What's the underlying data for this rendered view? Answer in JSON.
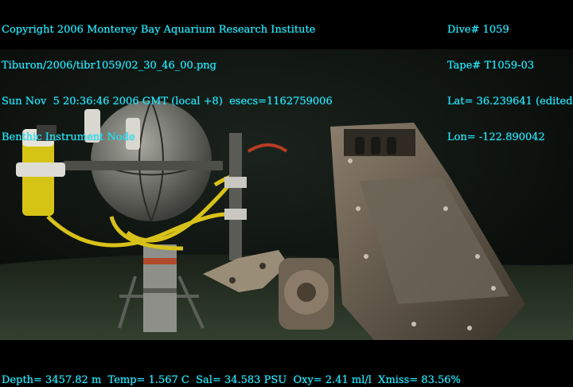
{
  "overlay": {
    "top_left": [
      "Copyright 2006 Monterey Bay Aquarium Research Institute",
      "Tiburon/2006/tibr1059/02_30_46_00.png",
      "Sun Nov  5 20:36:46 2006 GMT (local +8)  esecs=1162759006",
      "Benthic Instrument Node"
    ],
    "top_right": [
      "Dive# 1059",
      "Tape# T1059-03",
      "Lat= 36.239641 (edited)",
      "Lon= -122.890042"
    ],
    "bottom": "Depth= 3457.82 m  Temp= 1.567 C  Sal= 34.583 PSU  Oxy= 2.41 ml/l  Xmiss= 83.56%"
  },
  "colors": {
    "overlay_text": "#2ee6ff",
    "water": "#0d1410",
    "sediment": "#2a3328",
    "sphere": "#6e6e66",
    "yellow_cable": "#d8c21a",
    "housing": "#4a4238"
  }
}
